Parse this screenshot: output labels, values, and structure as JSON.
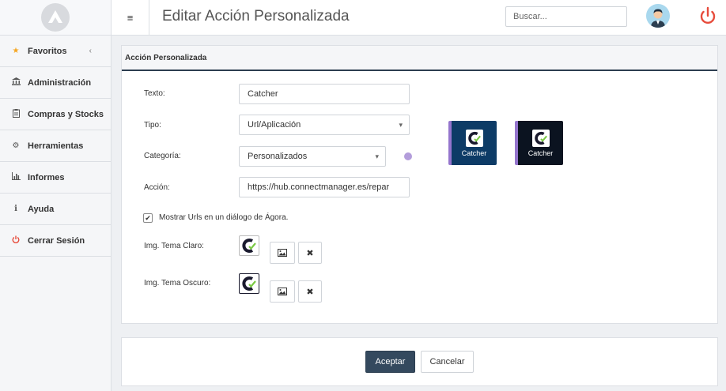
{
  "app": {
    "title": "Editar Acción Personalizada"
  },
  "search": {
    "placeholder": "Buscar..."
  },
  "sidebar": {
    "items": [
      {
        "label": "Favoritos",
        "icon": "star-icon",
        "chevron": "‹"
      },
      {
        "label": "Administración",
        "icon": "bank-icon"
      },
      {
        "label": "Compras y Stocks",
        "icon": "clipboard-icon"
      },
      {
        "label": "Herramientas",
        "icon": "gears-icon"
      },
      {
        "label": "Informes",
        "icon": "bar-chart-icon"
      },
      {
        "label": "Ayuda",
        "icon": "info-icon"
      },
      {
        "label": "Cerrar Sesión",
        "icon": "power-icon"
      }
    ]
  },
  "form": {
    "section_title": "Acción Personalizada",
    "texto_label": "Texto:",
    "texto_value": "Catcher",
    "tipo_label": "Tipo:",
    "tipo_value": "Url/Aplicación",
    "categoria_label": "Categoría:",
    "categoria_value": "Personalizados",
    "accion_label": "Acción:",
    "accion_value": "https://hub.connectmanager.es/repar",
    "checkbox_label": "Mostrar Urls en un diálogo de Ágora.",
    "checkbox_checked": true,
    "img_claro_label": "Img. Tema Claro:",
    "img_oscuro_label": "Img. Tema Oscuro:",
    "category_color": "#b39ddb"
  },
  "preview": {
    "light_label": "Catcher",
    "dark_label": "Catcher",
    "light_bg": "#0d3b66",
    "dark_bg": "#0b1320"
  },
  "footer": {
    "accept_label": "Aceptar",
    "cancel_label": "Cancelar"
  },
  "colors": {
    "accent": "#34495e",
    "power": "#e74c3c"
  }
}
